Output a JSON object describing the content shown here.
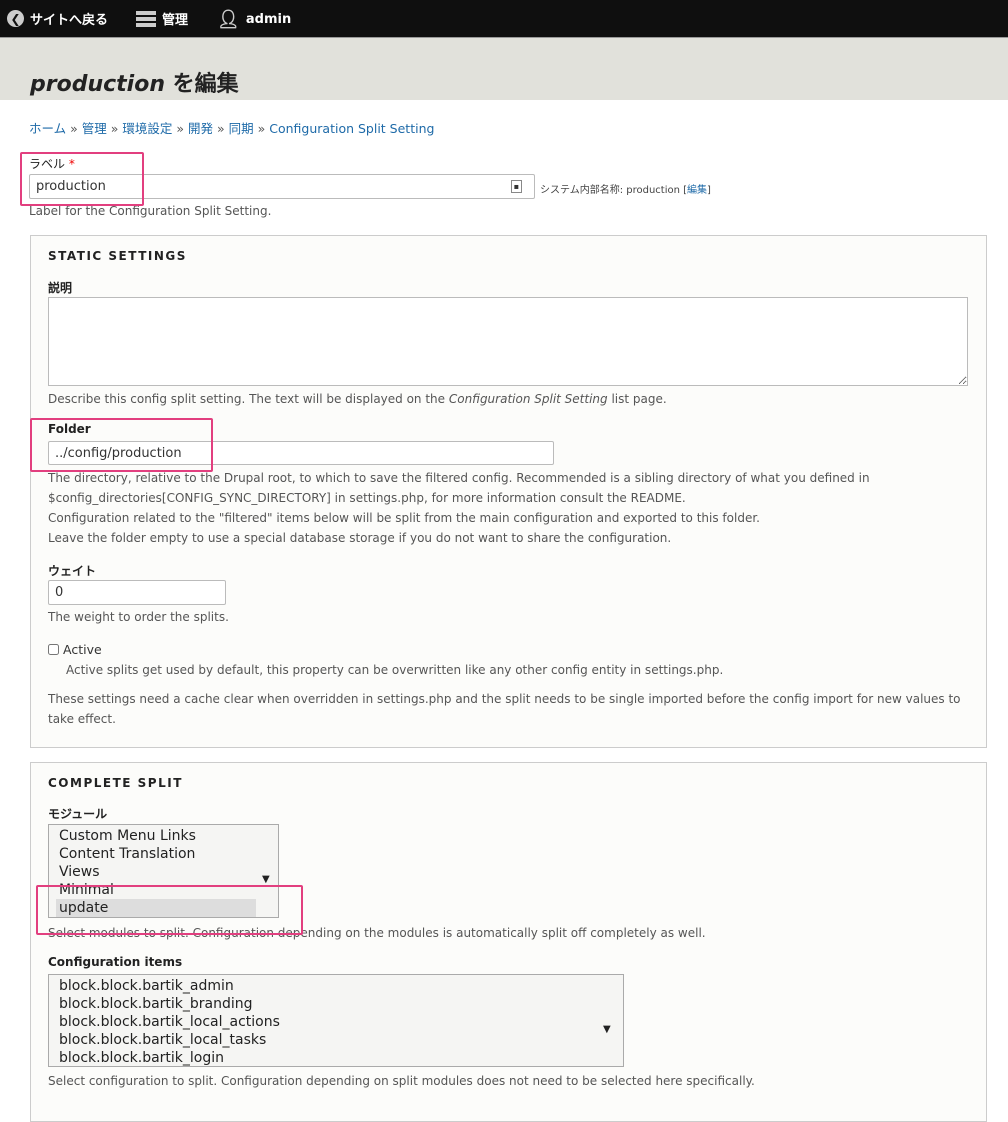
{
  "toolbar": {
    "back": "サイトへ戻る",
    "manage": "管理",
    "user": "admin"
  },
  "page": {
    "title_italic": "production",
    "title_rest": " を編集"
  },
  "breadcrumb": [
    "ホーム",
    "管理",
    "環境設定",
    "開発",
    "同期",
    "Configuration Split Setting"
  ],
  "label_field": {
    "label": "ラベル",
    "required": "*",
    "value": "production",
    "machine_prefix": "システム内部名称: production [",
    "machine_edit": "編集",
    "machine_suffix": "]",
    "description": "Label for the Configuration Split Setting."
  },
  "static": {
    "legend": "STATIC SETTINGS",
    "description_label": "説明",
    "description_value": "",
    "description_help_pre": "Describe this config split setting. The text will be displayed on the ",
    "description_help_em": "Configuration Split Setting",
    "description_help_post": " list page.",
    "folder_label": "Folder",
    "folder_value": "../config/production",
    "folder_help": [
      "The directory, relative to the Drupal root, to which to save the filtered config. Recommended is a sibling directory of what you defined in",
      "$config_directories[CONFIG_SYNC_DIRECTORY] in settings.php, for more information consult the README.",
      "Configuration related to the \"filtered\" items below will be split from the main configuration and exported to this folder.",
      "Leave the folder empty to use a special database storage if you do not want to share the configuration."
    ],
    "weight_label": "ウェイト",
    "weight_value": "0",
    "weight_help": "The weight to order the splits.",
    "active_label": "Active",
    "active_checked": false,
    "active_help": "Active splits get used by default, this property can be overwritten like any other config entity in settings.php.",
    "note": [
      "These settings need a cache clear when overridden in settings.php and the split needs to be single imported before the config import for new values to",
      "take effect."
    ]
  },
  "complete": {
    "legend": "COMPLETE SPLIT",
    "modules_label": "モジュール",
    "modules": [
      "Custom Menu Links",
      "Content Translation",
      "Views",
      "Minimal",
      "update"
    ],
    "modules_selected": "update",
    "modules_help": "Select modules to split. Configuration depending on the modules is automatically split off completely as well.",
    "config_label": "Configuration items",
    "config_items": [
      "block.block.bartik_admin",
      "block.block.bartik_branding",
      "block.block.bartik_local_actions",
      "block.block.bartik_local_tasks",
      "block.block.bartik_login"
    ],
    "config_help": "Select configuration to split. Configuration depending on split modules does not need to be selected here specifically."
  },
  "colors": {
    "link": "#1e6aa8",
    "highlight": "#e23f7f",
    "toolbar": "#0f0f0f"
  }
}
